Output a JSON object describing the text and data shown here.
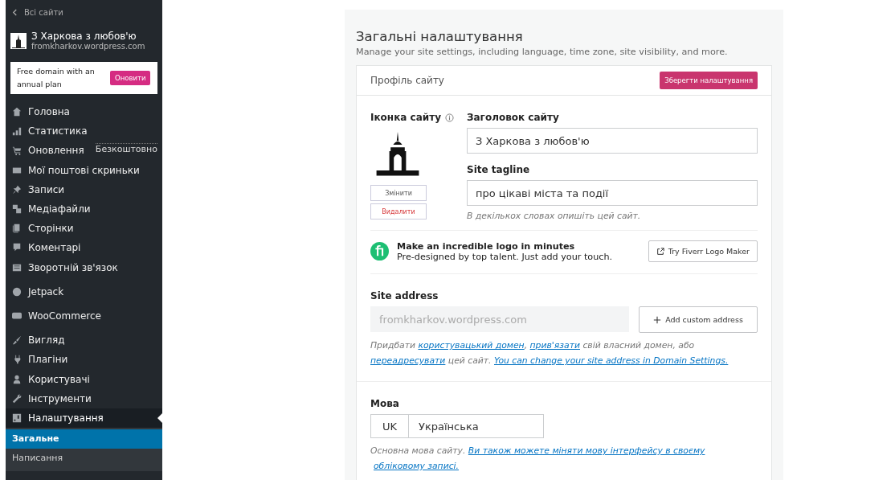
{
  "sidebar": {
    "back_link": "Всі сайти",
    "site": {
      "name": "З Харкова з любов'ю",
      "url": "fromkharkov.wordpress.com"
    },
    "promo": {
      "text": "Free domain with an annual plan",
      "button": "Оновити"
    },
    "menu_groups": [
      [
        {
          "label": "Головна",
          "selected": false
        },
        {
          "label": "Статистика",
          "selected": false
        },
        {
          "label": "Оновлення",
          "selected": false,
          "badge": "Безкоштовно"
        },
        {
          "label": "Мої поштові скриньки",
          "selected": false
        },
        {
          "label": "Записи",
          "selected": false
        },
        {
          "label": "Медіафайли",
          "selected": false
        },
        {
          "label": "Сторінки",
          "selected": false
        },
        {
          "label": "Коментарі",
          "selected": false
        },
        {
          "label": "Зворотній зв'язок",
          "selected": false
        }
      ],
      [
        {
          "label": "Jetpack",
          "selected": false
        }
      ],
      [
        {
          "label": "WooCommerce",
          "selected": false
        }
      ],
      [
        {
          "label": "Вигляд",
          "selected": false
        },
        {
          "label": "Плагіни",
          "selected": false
        },
        {
          "label": "Користувачі",
          "selected": false
        },
        {
          "label": "Інструменти",
          "selected": false
        },
        {
          "label": "Налаштування",
          "selected": true,
          "children": [
            {
              "label": "Загальне",
              "selected": true
            },
            {
              "label": "Написання",
              "selected": false
            }
          ]
        }
      ]
    ]
  },
  "page": {
    "title": "Загальні налаштування",
    "subtitle": "Manage your site settings, including language, time zone, site visibility, and more.",
    "card": {
      "header": "Профіль сайту",
      "save_button": "Зберегти налаштування",
      "site_icon": {
        "label": "Іконка сайту",
        "change_button": "Змінити",
        "remove_button": "Видалити"
      },
      "title_field": {
        "label": "Заголовок сайту",
        "value": "З Харкова з любов'ю"
      },
      "tagline_field": {
        "label": "Site tagline",
        "value": "про цікаві міста та події",
        "hint": "В декількох словах опишіть цей сайт."
      },
      "promo": {
        "title": "Make an incredible logo in minutes",
        "text": "Pre-designed by top talent. Just add your touch.",
        "button": "Try Fiverr Logo Maker"
      },
      "site_address": {
        "label": "Site address",
        "value": "fromkharkov.wordpress.com",
        "button": "Add custom address",
        "help": [
          {
            "text": "Придбати ",
            "link": false
          },
          {
            "text": "користувацький домен",
            "link": true
          },
          {
            "text": ", ",
            "link": false
          },
          {
            "text": "прив'язати",
            "link": true
          },
          {
            "text": " свій власний домен, або ",
            "link": false
          },
          {
            "text": "переадресувати",
            "link": true
          },
          {
            "text": " цей сайт. ",
            "link": false
          },
          {
            "text": "You can change your site address in Domain Settings.",
            "link": true
          }
        ]
      },
      "language": {
        "label": "Мова",
        "code": "UK",
        "value": "Українська",
        "help": [
          {
            "text": "Основна мова сайту. ",
            "link": false
          },
          {
            "text": "Ви також можете міняти мову інтерфейсу в своєму",
            "link": true
          },
          {
            "text": "обліковому записі.",
            "link": true
          }
        ]
      }
    }
  }
}
